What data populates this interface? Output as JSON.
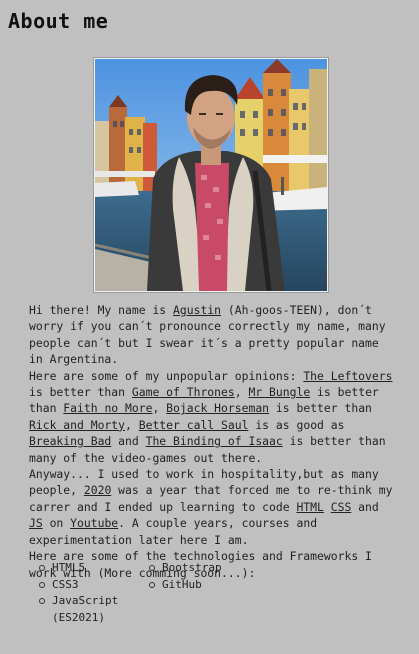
{
  "heading": "About me",
  "photo": {
    "alt": "Portrait of Agustin in front of colorful harbor houses"
  },
  "bio": {
    "p1_a": "Hi there! My name is ",
    "name_link": "Agustin",
    "p1_b": " (Ah-goos-TEEN), don´t worry if you can´t pronounce correctly my name, many people can´t but I swear it´s a pretty popular name in Argentina.",
    "p2_a": "Here are some of my unpopular opinions: ",
    "link_leftovers": "The Leftovers",
    "p2_b": " is better than ",
    "link_got": "Game of Thrones",
    "p2_c": ", ",
    "link_mrbungle": "Mr Bungle",
    "p2_d": " is better than ",
    "link_fnm": "Faith no More",
    "p2_e": ", ",
    "link_bojack": "Bojack Horseman",
    "p2_f": " is better than ",
    "link_rickmorty": "Rick and Morty",
    "p2_g": ", ",
    "link_bcs": "Better call Saul",
    "p2_h": " is as good as ",
    "link_bb": "Breaking Bad",
    "p2_i": " and ",
    "link_isaac": "The Binding of Isaac",
    "p2_j": " is better than many of the video-games out there.",
    "p3_a": "Anyway... I used to work in hospitality,but as many people, ",
    "link_2020": "2020",
    "p3_b": " was a year that forced me to re-think my carrer and I ended up learning to code ",
    "link_html": "HTML",
    "p3_c": " ",
    "link_css": "CSS",
    "p3_d": " and ",
    "link_js": "JS",
    "p3_e": " on ",
    "link_youtube": "Youtube",
    "p3_f": ". A couple years, courses and experimentation later here I am.",
    "p4": "Here are some of the technologies and Frameworks I work with (More comming soon...):"
  },
  "technologies": {
    "col1": [
      "HTML5",
      "CSS3",
      "JavaScript (ES2021)"
    ],
    "col2": [
      "Bootstrap",
      "GitHub"
    ]
  }
}
